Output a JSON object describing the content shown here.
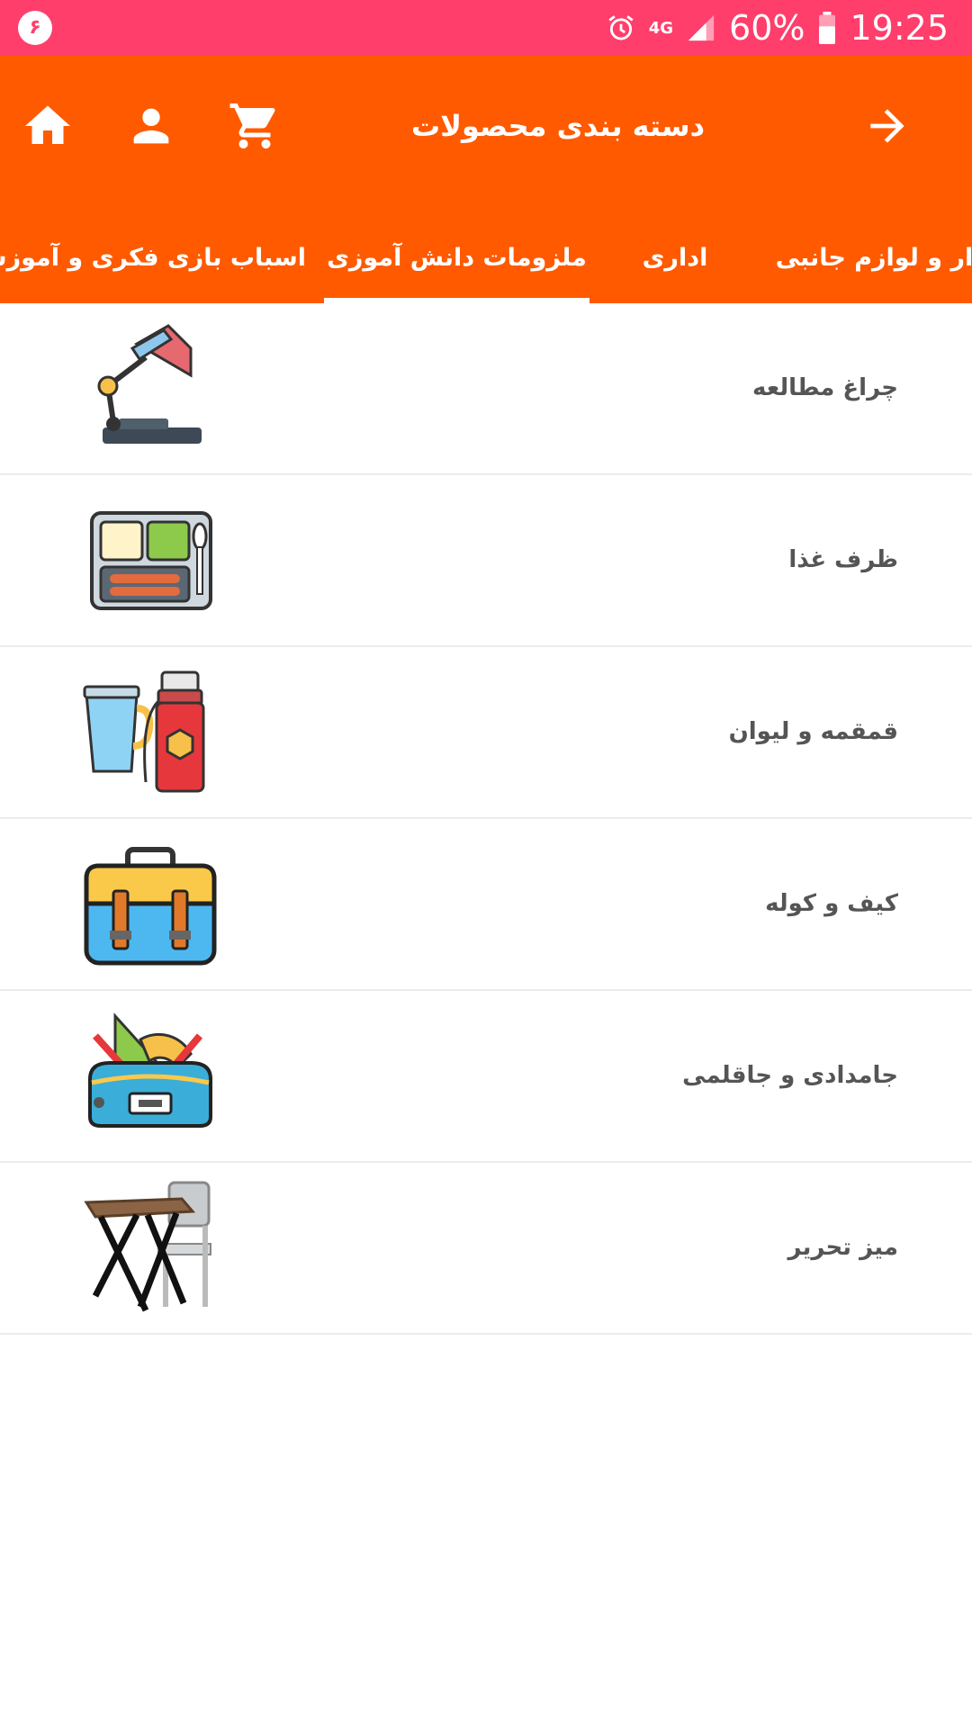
{
  "status_bar": {
    "notification_badge": "۶",
    "battery_percent": "60%",
    "time": "19:25",
    "network": "4G"
  },
  "app_bar": {
    "title": "دسته بندی محصولات",
    "icons": [
      "home-icon",
      "person-icon",
      "cart-icon",
      "arrow-forward-icon"
    ],
    "background_color": "#ff5a00"
  },
  "tabs": [
    {
      "label": "افزار و لوازم جانبی",
      "selected": false
    },
    {
      "label": "اداری",
      "selected": false
    },
    {
      "label": "ملزومات دانش آموزی",
      "selected": true
    },
    {
      "label": "اسباب بازی فکری و آموزشی",
      "selected": false
    }
  ],
  "categories": [
    {
      "label": "چراغ مطالعه",
      "icon": "desk-lamp-icon"
    },
    {
      "label": "ظرف غذا",
      "icon": "lunch-box-icon"
    },
    {
      "label": "قمقمه و لیوان",
      "icon": "flask-and-cup-icon"
    },
    {
      "label": "کیف و کوله",
      "icon": "school-bag-icon"
    },
    {
      "label": "جامدادی و جاقلمی",
      "icon": "pencil-case-icon"
    },
    {
      "label": "میز تحریر",
      "icon": "writing-desk-icon"
    }
  ],
  "colors": {
    "status_bar": "#ff3e6c",
    "accent": "#ff5a00"
  }
}
